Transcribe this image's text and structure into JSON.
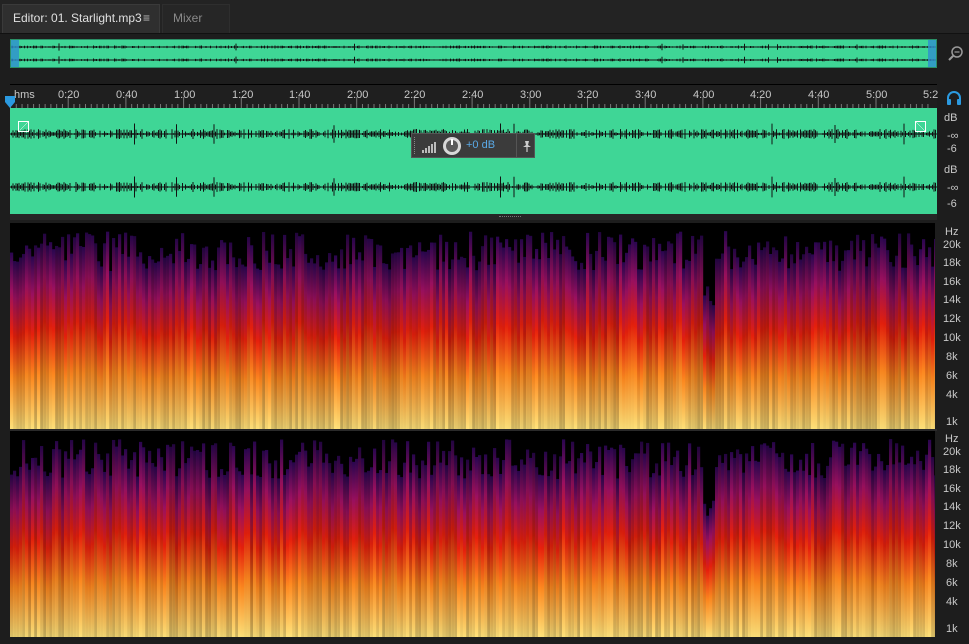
{
  "tabs": {
    "editor": "Editor: 01. Starlight.mp3",
    "editor_menu": "≡",
    "mixer": "Mixer"
  },
  "ruler": {
    "unit": "hms",
    "ticks": [
      "0:20",
      "0:40",
      "1:00",
      "1:20",
      "1:40",
      "2:00",
      "2:20",
      "2:40",
      "3:00",
      "3:20",
      "3:40",
      "4:00",
      "4:20",
      "4:40",
      "5:00",
      "5:2"
    ]
  },
  "gain_hud": {
    "value": "+0 dB"
  },
  "db_scale": {
    "channel1": [
      "dB",
      "-∞",
      "-6"
    ],
    "channel2": [
      "dB",
      "-∞",
      "-6"
    ]
  },
  "spectrum_scale": {
    "unit": "Hz",
    "labels": [
      "20k",
      "18k",
      "16k",
      "14k",
      "12k",
      "10k",
      "8k",
      "6k",
      "4k",
      "1k"
    ]
  },
  "colors": {
    "waveform": "#3fd696",
    "accent": "#2b9ae0",
    "spectrum_low": "#ffe070",
    "spectrum_mid": "#ff5a10",
    "spectrum_high": "#b01060",
    "spectrum_top": "#3a0a70"
  },
  "icons": {
    "zoom": "zoom-magnifier-icon",
    "headphones": "headphones-icon",
    "playhead": "playhead-icon",
    "pin": "pin-icon",
    "level_meter": "level-bars-icon",
    "gain_knob": "gain-knob-icon"
  }
}
